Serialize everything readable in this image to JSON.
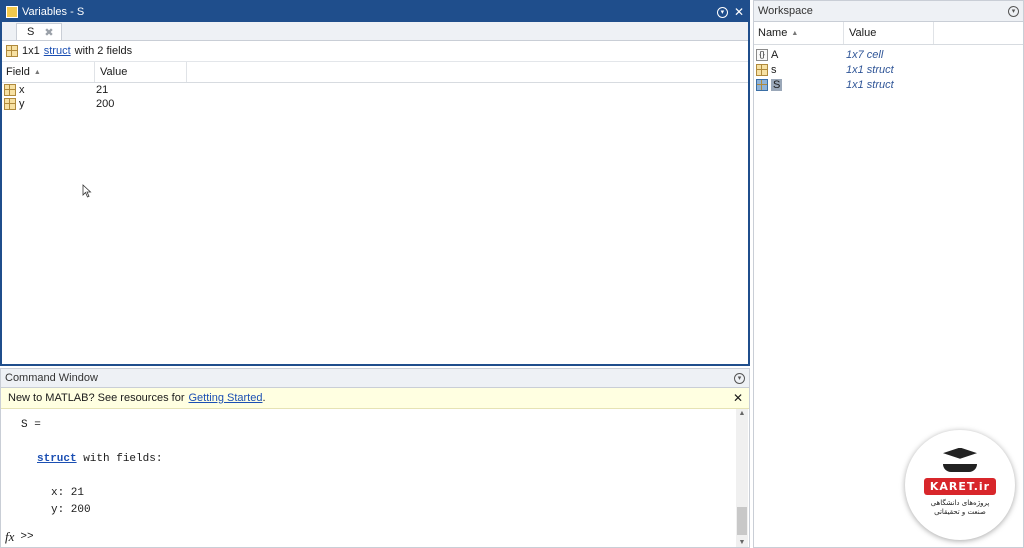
{
  "variables": {
    "title": "Variables - S",
    "tab_label": "S",
    "info_prefix": "1x1",
    "info_link": "struct",
    "info_suffix": "with 2 fields",
    "columns": [
      "Field",
      "Value"
    ],
    "rows": [
      {
        "field": "x",
        "value": "21"
      },
      {
        "field": "y",
        "value": "200"
      }
    ]
  },
  "workspace": {
    "title": "Workspace",
    "columns": [
      "Name",
      "Value"
    ],
    "rows": [
      {
        "icon": "cell-icon",
        "name": "A",
        "value": "1x7 cell"
      },
      {
        "icon": "struct-icon",
        "name": "s",
        "value": "1x1 struct"
      },
      {
        "icon": "struct-icon",
        "name": "S",
        "value": "1x1 struct",
        "selected": true
      }
    ]
  },
  "command": {
    "title": "Command Window",
    "notice_prefix": "New to MATLAB? See resources for",
    "notice_link": "Getting Started",
    "notice_suffix": ".",
    "output_line1": "S =",
    "output_kw": "struct",
    "output_line2_rest": " with fields:",
    "output_x": "x: 21",
    "output_y": "y: 200",
    "prompt": ">>",
    "fx": "fx"
  },
  "logo": {
    "brand": "KARET.ir",
    "subtitle_line1": "پروژه‌های دانشگاهی",
    "subtitle_line2": "صنعت و تحقیقاتی"
  },
  "colors": {
    "active_title": "#1f4e8c",
    "link": "#1b4fb3",
    "notice_bg": "#ffffe1",
    "brand_red": "#d8262b"
  }
}
